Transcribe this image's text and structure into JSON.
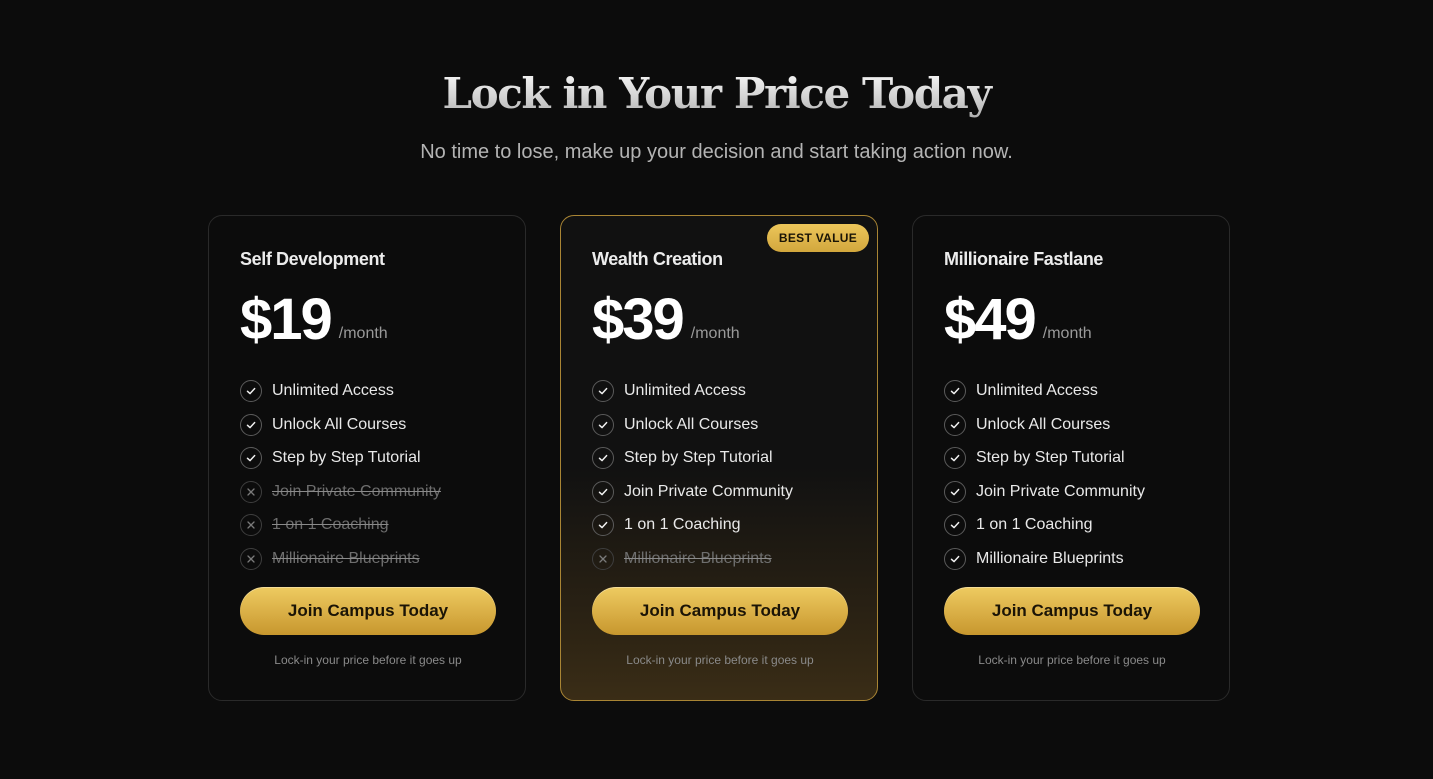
{
  "header": {
    "title": "Lock in Your Price Today",
    "subtitle": "No time to lose, make up your decision and start taking action now."
  },
  "colors": {
    "background": "#0c0c0c",
    "accent_gold": "#d9ae45",
    "featured_border": "#a98534",
    "card_border": "#2a2a2a"
  },
  "plans": [
    {
      "name": "Self Development",
      "price": "$19",
      "period": "/month",
      "features": [
        {
          "label": "Unlimited Access",
          "included": true
        },
        {
          "label": "Unlock All Courses",
          "included": true
        },
        {
          "label": "Step by Step Tutorial",
          "included": true
        },
        {
          "label": "Join Private Community",
          "included": false
        },
        {
          "label": "1 on 1 Coaching",
          "included": false
        },
        {
          "label": "Millionaire Blueprints",
          "included": false
        }
      ],
      "cta_label": "Join Campus Today",
      "note": "Lock-in your price before it goes up"
    },
    {
      "name": "Wealth Creation",
      "badge": "BEST VALUE",
      "price": "$39",
      "period": "/month",
      "features": [
        {
          "label": "Unlimited Access",
          "included": true
        },
        {
          "label": "Unlock All Courses",
          "included": true
        },
        {
          "label": "Step by Step Tutorial",
          "included": true
        },
        {
          "label": "Join Private Community",
          "included": true
        },
        {
          "label": "1 on 1 Coaching",
          "included": true
        },
        {
          "label": "Millionaire Blueprints",
          "included": false
        }
      ],
      "cta_label": "Join Campus Today",
      "note": "Lock-in your price before it goes up"
    },
    {
      "name": "Millionaire Fastlane",
      "price": "$49",
      "period": "/month",
      "features": [
        {
          "label": "Unlimited Access",
          "included": true
        },
        {
          "label": "Unlock All Courses",
          "included": true
        },
        {
          "label": "Step by Step Tutorial",
          "included": true
        },
        {
          "label": "Join Private Community",
          "included": true
        },
        {
          "label": "1 on 1 Coaching",
          "included": true
        },
        {
          "label": "Millionaire Blueprints",
          "included": true
        }
      ],
      "cta_label": "Join Campus Today",
      "note": "Lock-in your price before it goes up"
    }
  ]
}
